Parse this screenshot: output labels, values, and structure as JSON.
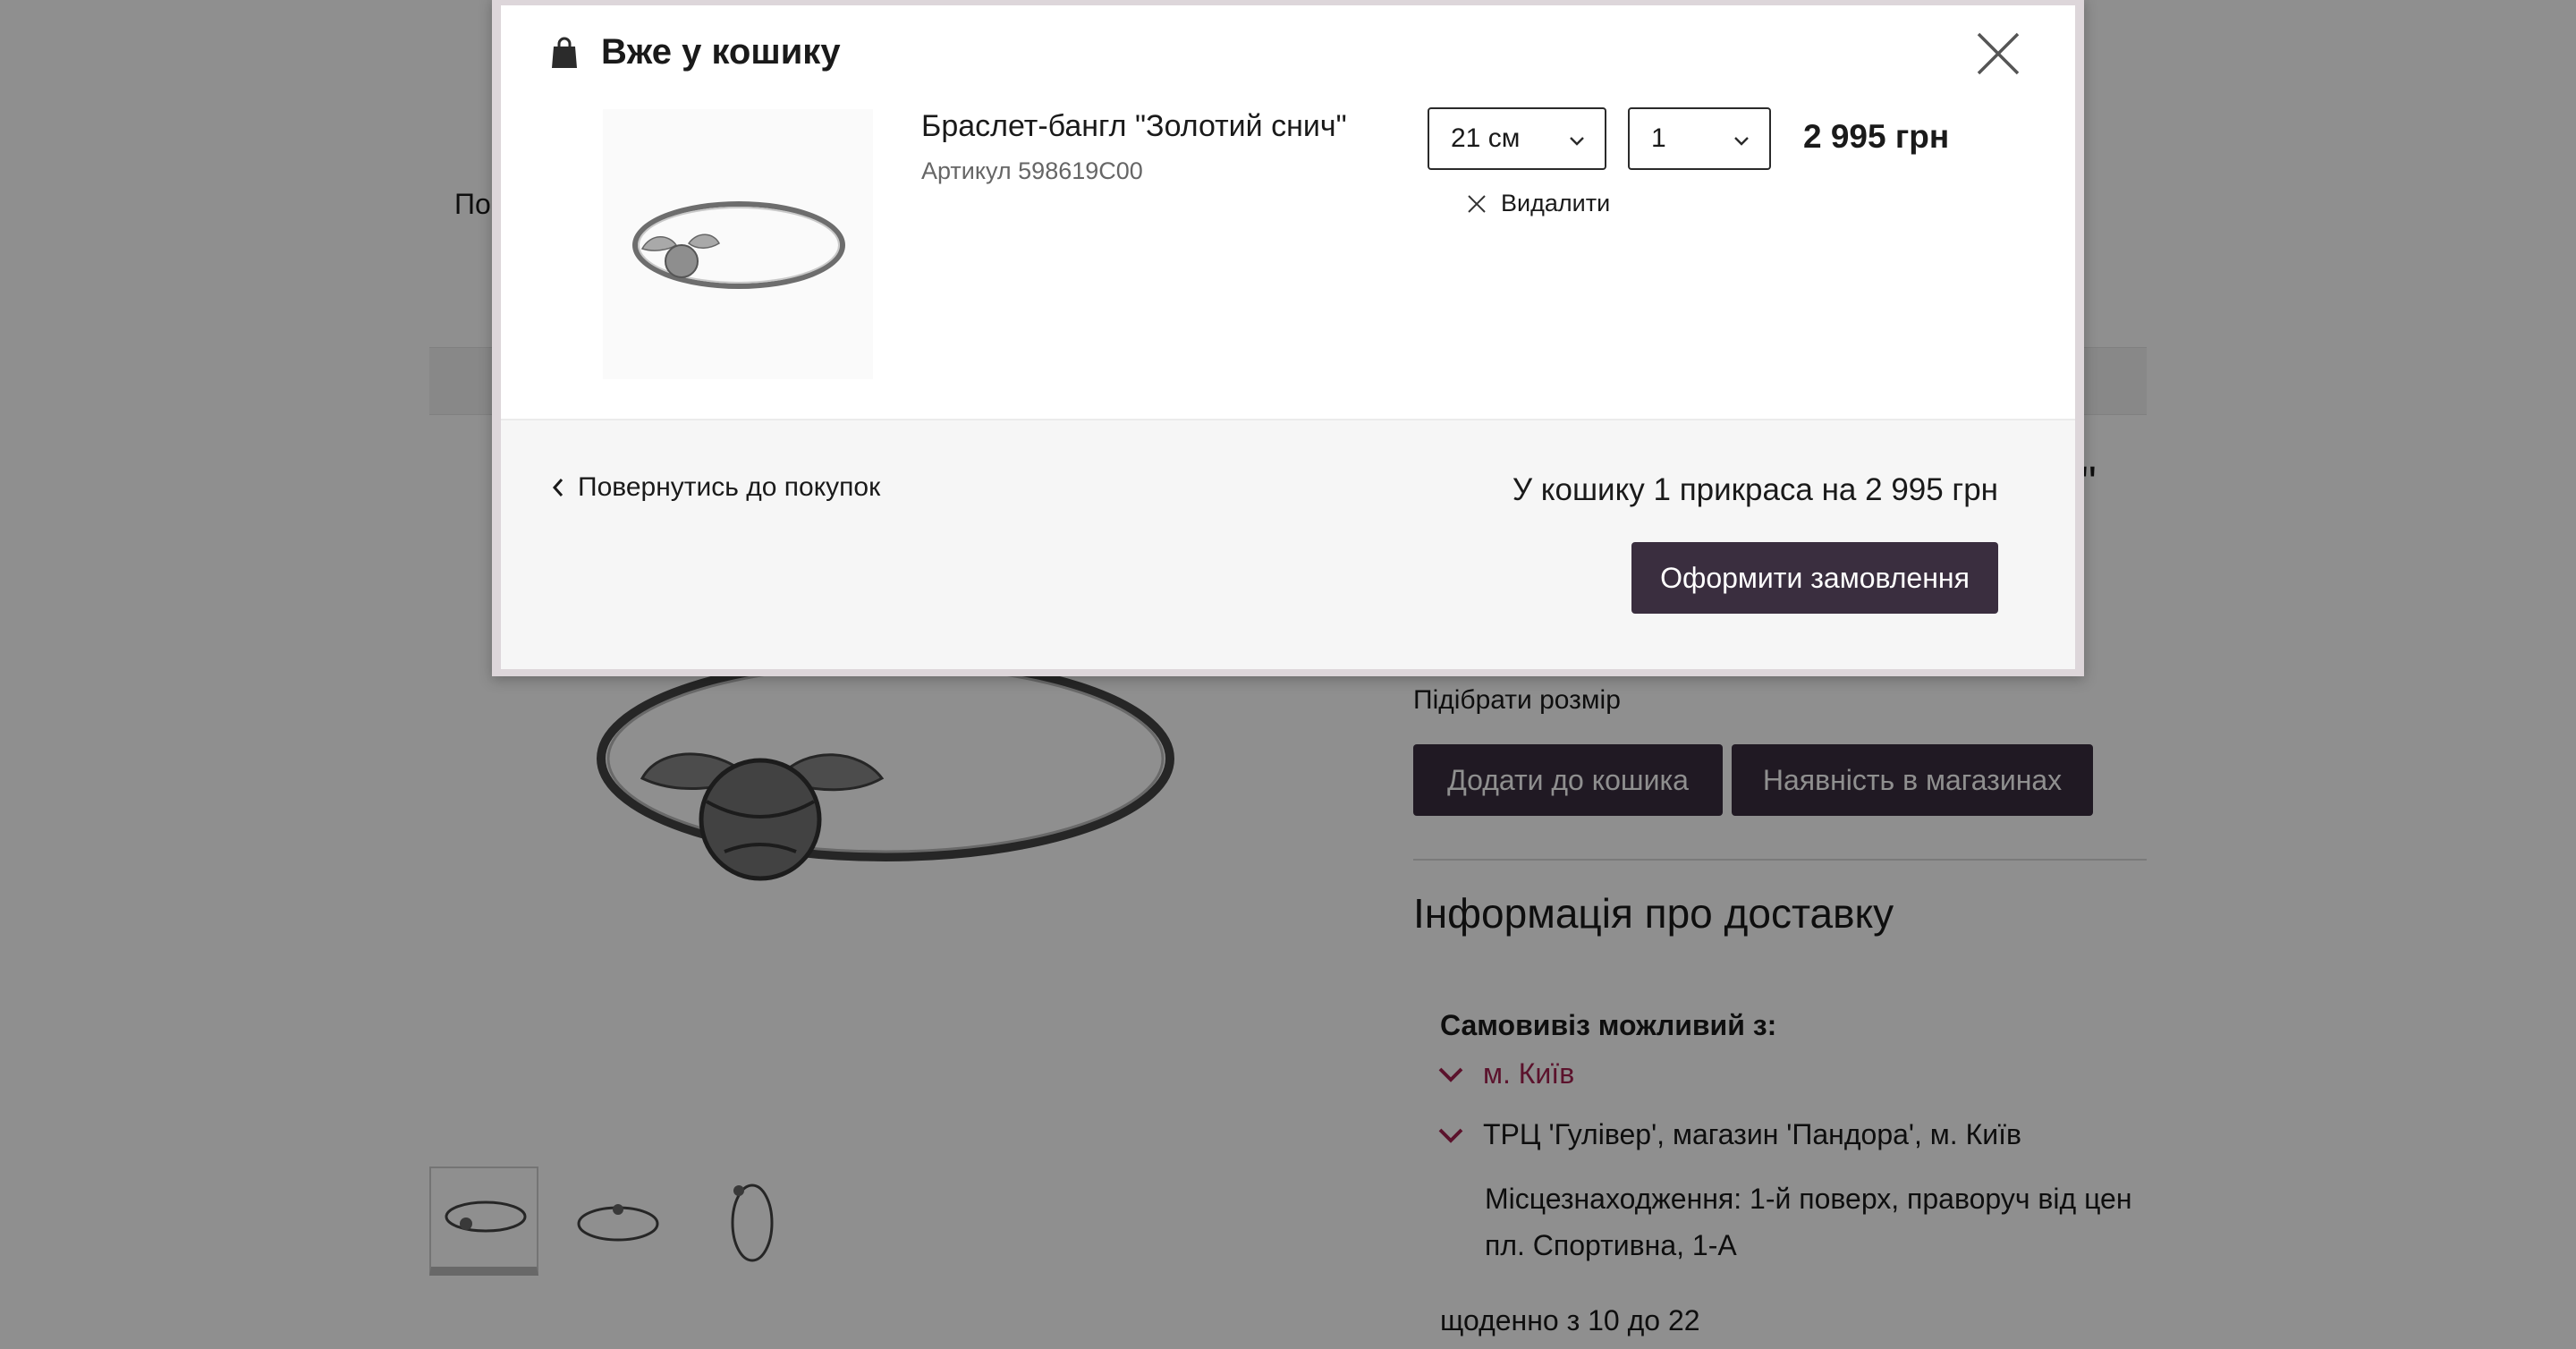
{
  "background": {
    "nav_fragment": "По",
    "title_fragment": "ч\"",
    "size_link": "Підібрати розмір",
    "add_to_cart": "Додати до кошика",
    "store_availability": "Наявність в магазинах",
    "delivery_title": "Інформація про доставку",
    "pickup_label": "Самовивіз можливий з:",
    "city": "м. Київ",
    "store": "ТРЦ 'Гулівер', магазин 'Пандора', м. Київ",
    "location_line1": "Місцезнаходження: 1-й поверх, праворуч від цен",
    "location_line2": "пл. Спортивна, 1-А",
    "hours": "щоденно з 10 до 22"
  },
  "modal": {
    "title": "Вже у кошику",
    "icons": {
      "bag": "shopping-bag-icon",
      "close": "close-icon",
      "remove": "x-icon",
      "back": "chevron-left-icon",
      "select": "chevron-down-icon"
    },
    "product": {
      "name": "Браслет-бангл \"Золотий снич\"",
      "sku": "Артикул 598619C00",
      "size": "21 см",
      "quantity": "1",
      "price": "2 995 грн",
      "remove_label": "Видалити"
    },
    "footer": {
      "back_label": "Повернутись до покупок",
      "summary": "У кошику 1 прикраса на 2 995 грн",
      "checkout_label": "Оформити замовлення"
    }
  },
  "colors": {
    "brand_button": "#3a2e3f",
    "accent_city": "#a3214f",
    "overlay": "rgba(0,0,0,0.44)"
  }
}
